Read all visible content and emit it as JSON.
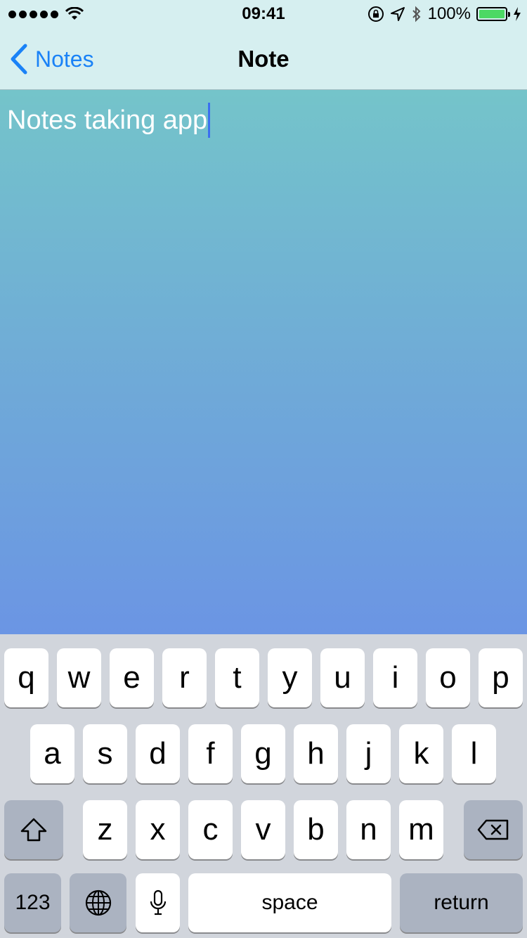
{
  "status_bar": {
    "time": "09:41",
    "battery_percent": "100%",
    "battery_level": 1.0,
    "battery_color": "#4cd964"
  },
  "nav": {
    "back_label": "Notes",
    "title": "Note"
  },
  "note": {
    "text": "Notes taking app"
  },
  "keyboard": {
    "row1": [
      "q",
      "w",
      "e",
      "r",
      "t",
      "y",
      "u",
      "i",
      "o",
      "p"
    ],
    "row2": [
      "a",
      "s",
      "d",
      "f",
      "g",
      "h",
      "j",
      "k",
      "l"
    ],
    "row3": [
      "z",
      "x",
      "c",
      "v",
      "b",
      "n",
      "m"
    ],
    "numbers_label": "123",
    "space_label": "space",
    "return_label": "return",
    "icons": [
      "shift-icon",
      "backspace-icon",
      "globe-icon",
      "microphone-icon"
    ]
  },
  "colors": {
    "accent": "#1a82f7",
    "gradient_top": "#74c4ca",
    "gradient_bottom": "#6b95e4",
    "caret": "#3b6ff0"
  }
}
